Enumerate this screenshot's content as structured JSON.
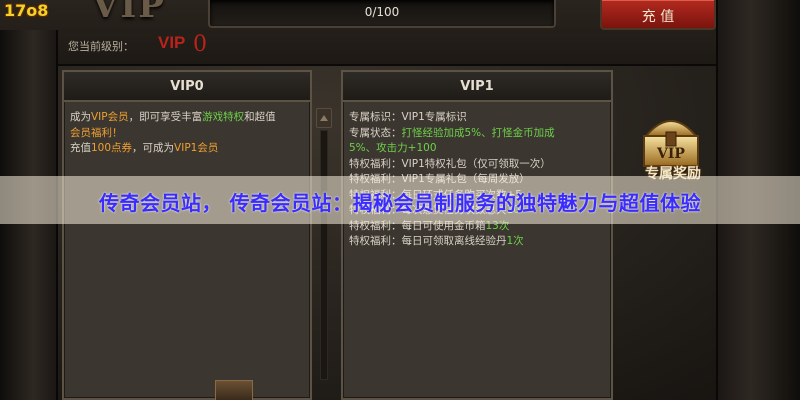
{
  "watermark": "17o8",
  "header": {
    "logo_text": "VIP",
    "progress_text": "0/100",
    "progress_fraction": 0,
    "recharge_label": "充 值",
    "level_label": "您当前级别：",
    "level_prefix": "VIP",
    "level_value": "0"
  },
  "panels": [
    {
      "title": "VIP0",
      "lines": [
        [
          {
            "t": "成为",
            "c": "white"
          },
          {
            "t": "VIP会员",
            "c": "orange"
          },
          {
            "t": "，即可享受丰富",
            "c": "white"
          },
          {
            "t": "游戏特权",
            "c": "green"
          },
          {
            "t": "和超值",
            "c": "white"
          }
        ],
        [
          {
            "t": "会员福利！",
            "c": "orange"
          }
        ],
        [
          {
            "t": "充值",
            "c": "white"
          },
          {
            "t": "100点券",
            "c": "orange"
          },
          {
            "t": "，可成为",
            "c": "white"
          },
          {
            "t": "VIP1会员",
            "c": "orange"
          }
        ]
      ]
    },
    {
      "title": "VIP1",
      "lines": [
        [
          {
            "t": "专属标识：VIP1专属标识",
            "c": "white"
          }
        ],
        [
          {
            "t": "专属状态：",
            "c": "white"
          },
          {
            "t": "打怪经验加成5%、打怪金币加成",
            "c": "green"
          }
        ],
        [
          {
            "t": "5%、攻击力+100",
            "c": "green"
          }
        ],
        [
          {
            "t": "特权福利：VIP1特权礼包（仅可领取一次）",
            "c": "white"
          }
        ],
        [
          {
            "t": "特权福利：VIP1专属礼包（每周发放）",
            "c": "white"
          }
        ],
        [
          {
            "t": "特权福利：每日环式任务购买次数+5",
            "c": "white"
          }
        ],
        [
          {
            "t": "特权福利：每次悬赏任务次数总共",
            "c": "white"
          },
          {
            "t": "10",
            "c": "green"
          }
        ],
        [
          {
            "t": "特权福利：每日可使用金币箱",
            "c": "white"
          },
          {
            "t": "13次",
            "c": "green"
          }
        ],
        [
          {
            "t": "特权福利：每日可领取离线经验丹",
            "c": "white"
          },
          {
            "t": "1次",
            "c": "green"
          }
        ]
      ]
    }
  ],
  "reward": {
    "icon_text": "VIP",
    "label": "专属奖励"
  },
  "banner": {
    "text": "传奇会员站， 传奇会员站：揭秘会员制服务的独特魅力与超值体验"
  },
  "colors": {
    "accent_orange": "#f0a030",
    "accent_green": "#6fd04a",
    "recharge_red": "#b32a1f",
    "banner_text": "#3a2cff"
  }
}
